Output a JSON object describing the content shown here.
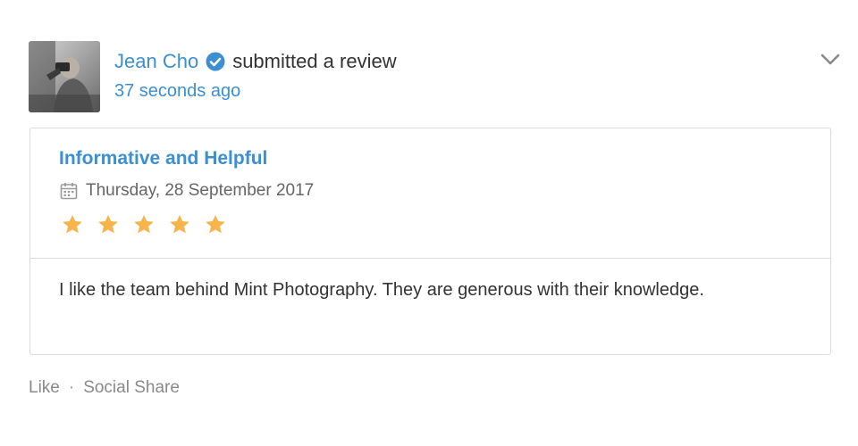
{
  "activity": {
    "author_name": "Jean Cho",
    "action_text": "submitted a review",
    "timestamp": "37 seconds ago",
    "avatar_alt": "Jean Cho profile photo",
    "verified_icon": "verified-check-icon",
    "menu_icon": "chevron-down-icon"
  },
  "review": {
    "title": "Informative and Helpful",
    "date": "Thursday, 28 September 2017",
    "date_icon": "calendar-icon",
    "rating": 5,
    "rating_max": 5,
    "body": "I like the team behind Mint Photography. They are generous with their knowledge."
  },
  "footer": {
    "like_label": "Like",
    "separator": "·",
    "share_label": "Social Share"
  },
  "colors": {
    "link_blue": "#3b8fd3",
    "star": "#f6b44b",
    "border": "#dcdcdc",
    "muted": "#8a8a8a"
  }
}
